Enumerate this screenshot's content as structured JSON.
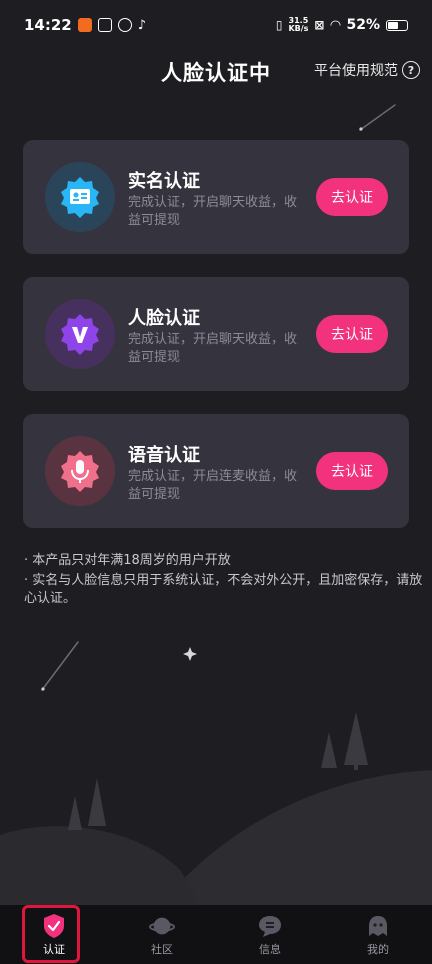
{
  "status_bar": {
    "time": "14:22",
    "net_speed_value": "31.5",
    "net_speed_unit": "KB/s",
    "battery": "52%"
  },
  "header": {
    "title": "人脸认证中",
    "rules_label": "平台使用规范",
    "help_glyph": "?"
  },
  "cards": [
    {
      "title": "实名认证",
      "desc": "完成认证，开启聊天收益，收益可提现",
      "button": "去认证",
      "icon": "id-card-icon",
      "icon_color": "#29b6f6"
    },
    {
      "title": "人脸认证",
      "desc": "完成认证，开启聊天收益，收益可提现",
      "button": "去认证",
      "icon": "v-badge-icon",
      "icon_color": "#8e44e8"
    },
    {
      "title": "语音认证",
      "desc": "完成认证，开启连麦收益，收益可提现",
      "button": "去认证",
      "icon": "microphone-icon",
      "icon_color": "#f06f8a"
    }
  ],
  "notes": [
    "· 本产品只对年满18周岁的用户开放",
    "· 实名与人脸信息只用于系统认证，不会对外公开，且加密保存，请放心认证。"
  ],
  "nav": [
    {
      "label": "认证",
      "icon": "shield-check-icon",
      "active": true
    },
    {
      "label": "社区",
      "icon": "planet-icon",
      "active": false
    },
    {
      "label": "信息",
      "icon": "message-icon",
      "active": false
    },
    {
      "label": "我的",
      "icon": "ghost-icon",
      "active": false
    }
  ],
  "colors": {
    "background": "#1e1e22",
    "card": "#35333d",
    "accent": "#f2327d",
    "active_outline": "#e0163c"
  }
}
